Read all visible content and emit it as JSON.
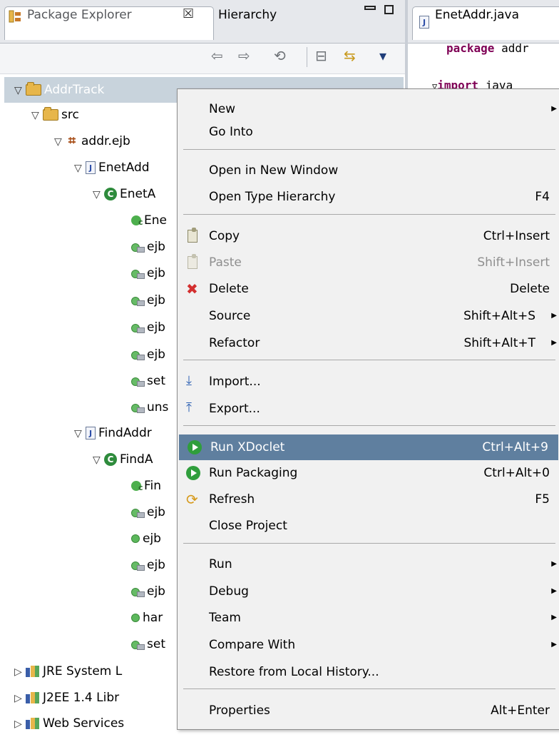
{
  "package_explorer": {
    "tab_label": "Package Explorer",
    "tab_close": "☒",
    "hierarchy_tab": "Hierarchy",
    "minimize": "▭",
    "toolbar": {
      "back": "⇦",
      "forward": "⇨",
      "link": "⟲",
      "collapse": "⊟",
      "sync": "⇆",
      "menu": "▾"
    },
    "tree": [
      {
        "label": "AddrTrack",
        "icon": "project-icon",
        "twisty": "▽"
      },
      {
        "label": "src",
        "icon": "source-folder-icon",
        "twisty": "▽"
      },
      {
        "label": "addr.ejb",
        "icon": "package-icon",
        "twisty": "▽"
      },
      {
        "label": "EnetAdd",
        "icon": "java-file-icon",
        "twisty": "▽"
      },
      {
        "label": "EnetA",
        "icon": "class-icon",
        "twisty": "▽",
        "badge": "C"
      },
      {
        "label": "Ene",
        "icon": "constructor-icon"
      },
      {
        "label": "ejb",
        "icon": "method-icon"
      },
      {
        "label": "ejb",
        "icon": "method-icon"
      },
      {
        "label": "ejb",
        "icon": "method-icon"
      },
      {
        "label": "ejb",
        "icon": "method-icon"
      },
      {
        "label": "ejb",
        "icon": "method-icon"
      },
      {
        "label": "set",
        "icon": "method-icon"
      },
      {
        "label": "uns",
        "icon": "method-icon"
      },
      {
        "label": "FindAddr",
        "icon": "java-file-icon",
        "twisty": "▽"
      },
      {
        "label": "FindA",
        "icon": "class-icon",
        "twisty": "▽",
        "badge": "C"
      },
      {
        "label": "Fin",
        "icon": "constructor-icon"
      },
      {
        "label": "ejb",
        "icon": "method-icon"
      },
      {
        "label": "ejb",
        "icon": "public-method-icon"
      },
      {
        "label": "ejb",
        "icon": "method-icon"
      },
      {
        "label": "ejb",
        "icon": "method-icon"
      },
      {
        "label": "har",
        "icon": "public-method-icon"
      },
      {
        "label": "set",
        "icon": "method-icon"
      },
      {
        "label": "JRE System L",
        "icon": "library-icon",
        "twisty": "▷"
      },
      {
        "label": "J2EE 1.4 Libr",
        "icon": "library-icon",
        "twisty": "▷"
      },
      {
        "label": "Web Services",
        "icon": "library-icon",
        "twisty": "▷"
      }
    ]
  },
  "editor": {
    "tab_label": "EnetAddr.java",
    "lines": [
      {
        "kw": "package",
        "rest": " addr"
      },
      {
        "kw": "import",
        "rest": " java",
        "fold": "▽"
      }
    ]
  },
  "context_menu": {
    "items": [
      {
        "label": "New",
        "mnemonic_index": 2,
        "shortcut": "",
        "submenu": true
      },
      {
        "label": "Go Into",
        "shortcut": ""
      },
      {
        "label": "Open in New Window",
        "shortcut": ""
      },
      {
        "label": "Open Type Hierarchy",
        "shortcut": "F4"
      },
      {
        "label": "Copy",
        "shortcut": "Ctrl+Insert",
        "icon": "copy-icon"
      },
      {
        "label": "Paste",
        "shortcut": "Shift+Insert",
        "icon": "paste-icon",
        "disabled": true
      },
      {
        "label": "Delete",
        "shortcut": "Delete",
        "icon": "delete-icon"
      },
      {
        "label": "Source",
        "shortcut": "Shift+Alt+S",
        "submenu": true
      },
      {
        "label": "Refactor",
        "shortcut": "Shift+Alt+T",
        "submenu": true
      },
      {
        "label": "Import...",
        "shortcut": "",
        "icon": "import-icon"
      },
      {
        "label": "Export...",
        "shortcut": "",
        "icon": "export-icon"
      },
      {
        "label": "Run XDoclet",
        "shortcut": "Ctrl+Alt+9",
        "icon": "run-icon",
        "highlighted": true
      },
      {
        "label": "Run Packaging",
        "shortcut": "Ctrl+Alt+0",
        "icon": "run-icon"
      },
      {
        "label": "Refresh",
        "shortcut": "F5",
        "icon": "refresh-icon"
      },
      {
        "label": "Close Project",
        "shortcut": ""
      },
      {
        "label": "Run",
        "shortcut": "",
        "submenu": true
      },
      {
        "label": "Debug",
        "shortcut": "",
        "submenu": true
      },
      {
        "label": "Team",
        "shortcut": "",
        "submenu": true
      },
      {
        "label": "Compare With",
        "shortcut": "",
        "submenu": true
      },
      {
        "label": "Restore from Local History...",
        "shortcut": ""
      },
      {
        "label": "Properties",
        "shortcut": "Alt+Enter"
      }
    ]
  },
  "colors": {
    "menu_highlight": "#5f7f9f",
    "tree_selection": "#c8d3dc",
    "keyword": "#7f0055"
  }
}
